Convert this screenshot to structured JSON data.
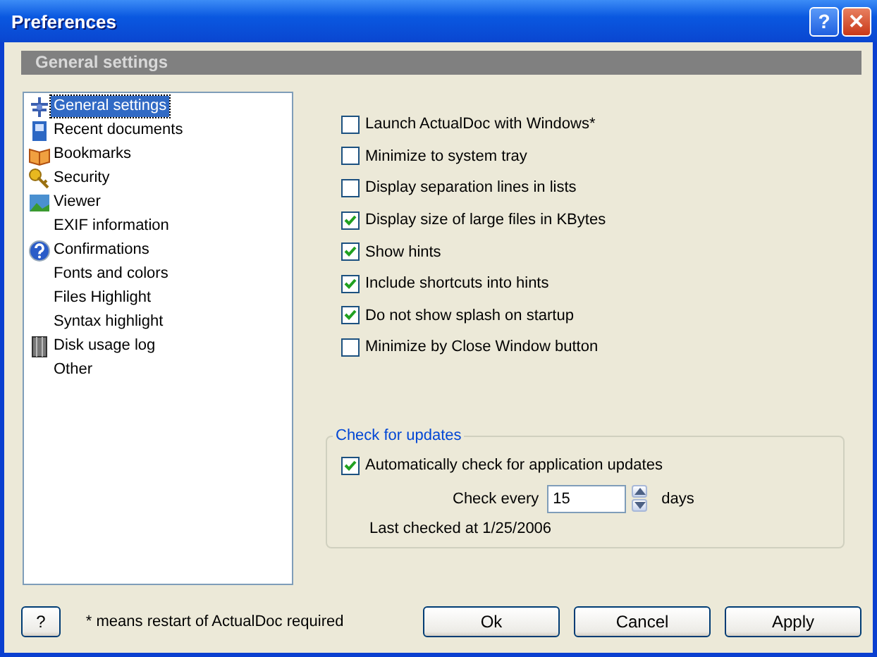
{
  "window": {
    "title": "Preferences",
    "help_button": "?",
    "close_button": "✕"
  },
  "header": "General settings",
  "sidebar": {
    "items": [
      {
        "label": "General settings",
        "selected": true
      },
      {
        "label": "Recent documents",
        "selected": false
      },
      {
        "label": "Bookmarks",
        "selected": false
      },
      {
        "label": "Security",
        "selected": false
      },
      {
        "label": "Viewer",
        "selected": false
      },
      {
        "label": "EXIF information",
        "selected": false
      },
      {
        "label": "Confirmations",
        "selected": false
      },
      {
        "label": "Fonts and colors",
        "selected": false
      },
      {
        "label": "Files Highlight",
        "selected": false
      },
      {
        "label": "Syntax highlight",
        "selected": false
      },
      {
        "label": "Disk usage log",
        "selected": false
      },
      {
        "label": "Other",
        "selected": false
      }
    ]
  },
  "options": [
    {
      "label": "Launch ActualDoc with Windows*",
      "checked": false
    },
    {
      "label": "Minimize to system tray",
      "checked": false
    },
    {
      "label": "Display separation lines in lists",
      "checked": false
    },
    {
      "label": "Display size of large files in KBytes",
      "checked": true
    },
    {
      "label": "Show hints",
      "checked": true
    },
    {
      "label": "Include shortcuts into hints",
      "checked": true
    },
    {
      "label": "Do not show splash on startup",
      "checked": true
    },
    {
      "label": "Minimize by Close Window button",
      "checked": false
    }
  ],
  "updates": {
    "title": "Check for updates",
    "auto_check": {
      "label": "Automatically check for application updates",
      "checked": true
    },
    "interval_label": "Check every",
    "interval_value": "15",
    "interval_unit": "days",
    "last_checked": "Last checked at 1/25/2006"
  },
  "footer": {
    "help_button": "?",
    "note": "* means restart of ActualDoc required",
    "buttons": [
      "Ok",
      "Cancel",
      "Apply"
    ]
  }
}
